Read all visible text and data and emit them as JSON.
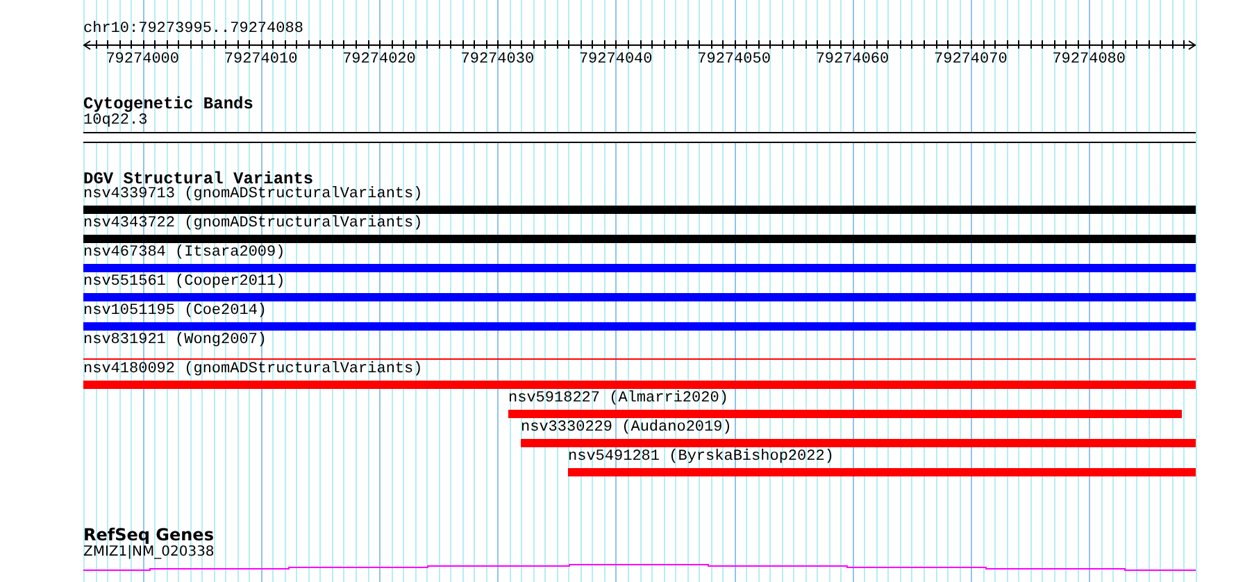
{
  "location": "chr10:79273995..79274088",
  "ruler": {
    "labels": [
      "79274000",
      "79274010",
      "79274020",
      "79274030",
      "79274040",
      "79274050",
      "79274060",
      "79274070",
      "79274080"
    ]
  },
  "cytogenetic_bands": {
    "title": "Cytogenetic Bands",
    "band": "10q22.3"
  },
  "dgv_structural_variants": {
    "title": "DGV Structural Variants",
    "features": [
      {
        "label": "nsv4339713 (gnomADStructuralVariants)",
        "color": "#000000",
        "kind": "thick"
      },
      {
        "label": "nsv4343722 (gnomADStructuralVariants)",
        "color": "#000000",
        "kind": "thick"
      },
      {
        "label": "nsv467384 (Itsara2009)",
        "color": "#0000ff",
        "kind": "thick"
      },
      {
        "label": "nsv551561 (Cooper2011)",
        "color": "#0000ff",
        "kind": "thick"
      },
      {
        "label": "nsv1051195 (Coe2014)",
        "color": "#0000ff",
        "kind": "thick"
      },
      {
        "label": "nsv831921 (Wong2007)",
        "color": "#ff0000",
        "kind": "thin"
      },
      {
        "label": "nsv4180092 (gnomADStructuralVariants)",
        "color": "#ff0000",
        "kind": "thick"
      },
      {
        "label": "nsv5918227 (Almarri2020)",
        "color": "#ff0000",
        "kind": "thick"
      },
      {
        "label": "nsv3330229 (Audano2019)",
        "color": "#ff0000",
        "kind": "thick"
      },
      {
        "label": "nsv5491281 (ByrskaBishop2022)",
        "color": "#ff0000",
        "kind": "thick"
      }
    ]
  },
  "refseq_genes": {
    "title": "RefSeq Genes",
    "gene": "ZMIZ1|NM_020338"
  }
}
